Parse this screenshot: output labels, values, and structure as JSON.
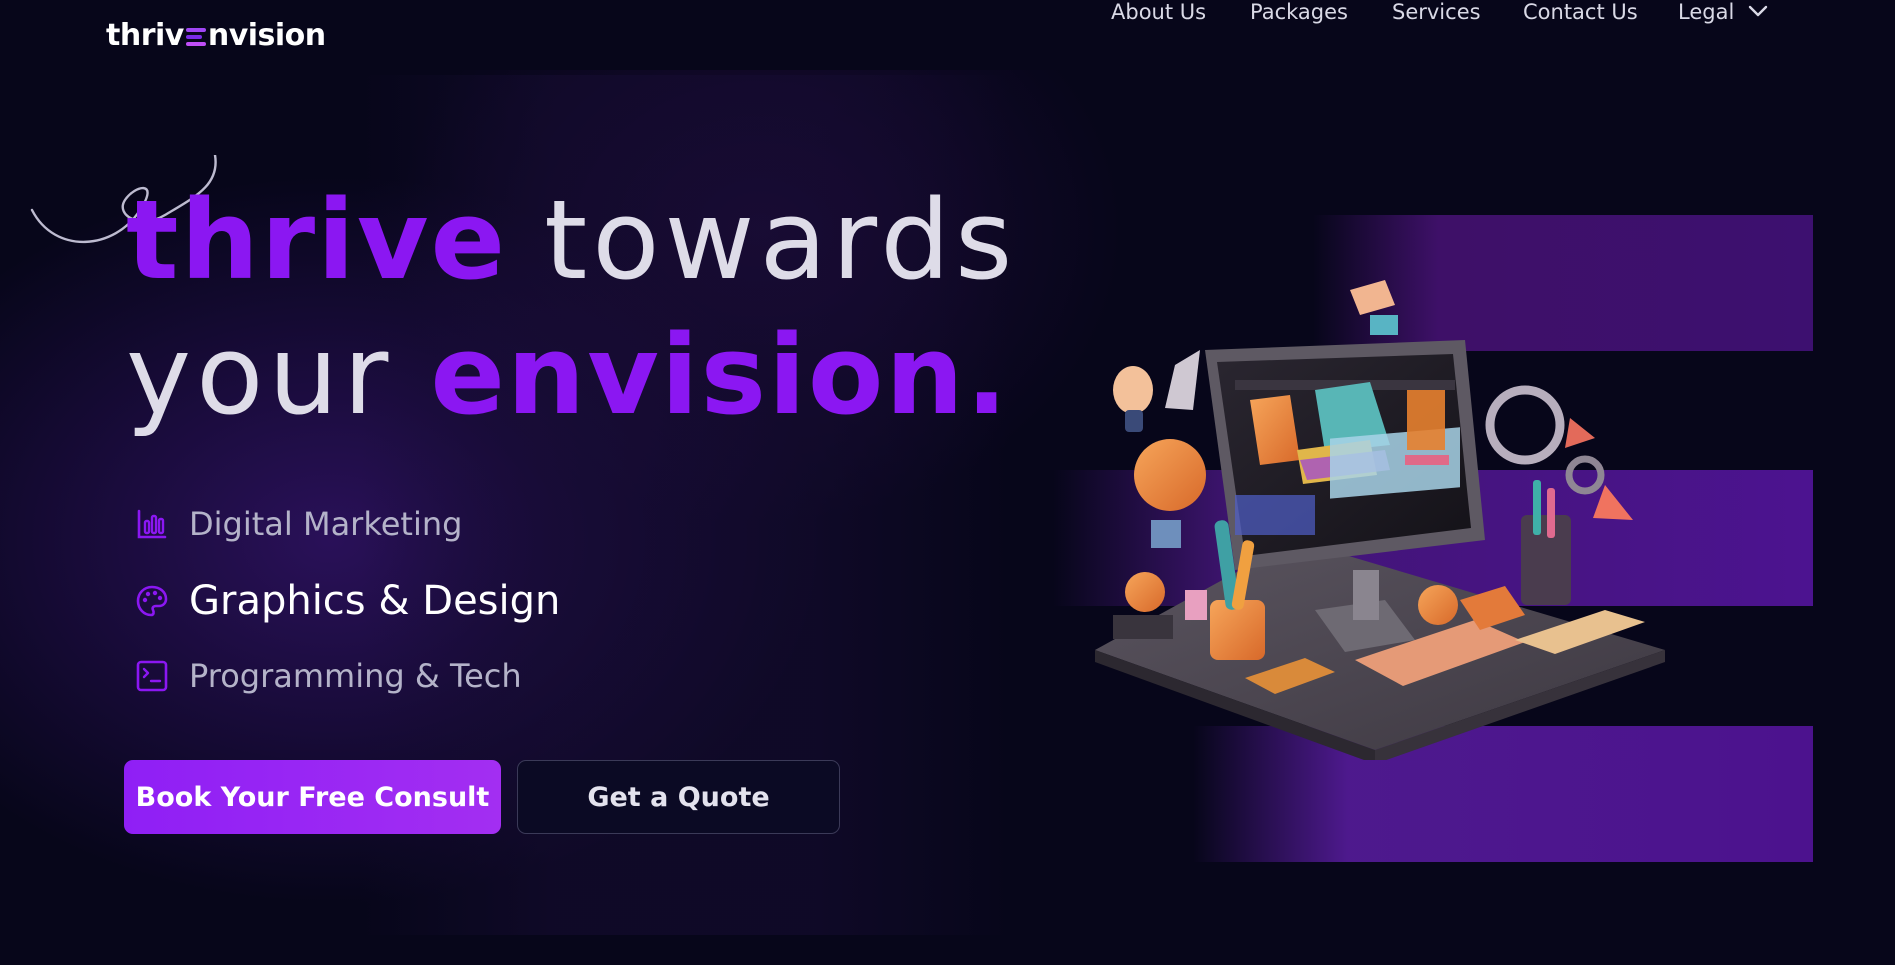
{
  "header": {
    "logo": {
      "part1": "thriv",
      "part2": "nvision"
    },
    "nav": [
      {
        "label": "About Us"
      },
      {
        "label": "Packages"
      },
      {
        "label": "Services"
      },
      {
        "label": "Contact Us"
      },
      {
        "label": "Legal"
      }
    ]
  },
  "hero": {
    "line1": {
      "accent": "thrive",
      "rest": "towards"
    },
    "line2": {
      "lead": "your",
      "accent": "envision",
      "dot": "."
    },
    "services": [
      {
        "label": "Digital Marketing",
        "icon": "bar-chart-icon"
      },
      {
        "label": "Graphics & Design",
        "icon": "palette-icon"
      },
      {
        "label": "Programming & Tech",
        "icon": "terminal-icon"
      }
    ],
    "buttons": {
      "primary": "Book Your Free Consult",
      "secondary": "Get a Quote"
    }
  },
  "colors": {
    "background": "#07061a",
    "accent": "#8b17f2",
    "stripe": "#4c1390",
    "nav_text": "#d9d9e6"
  }
}
